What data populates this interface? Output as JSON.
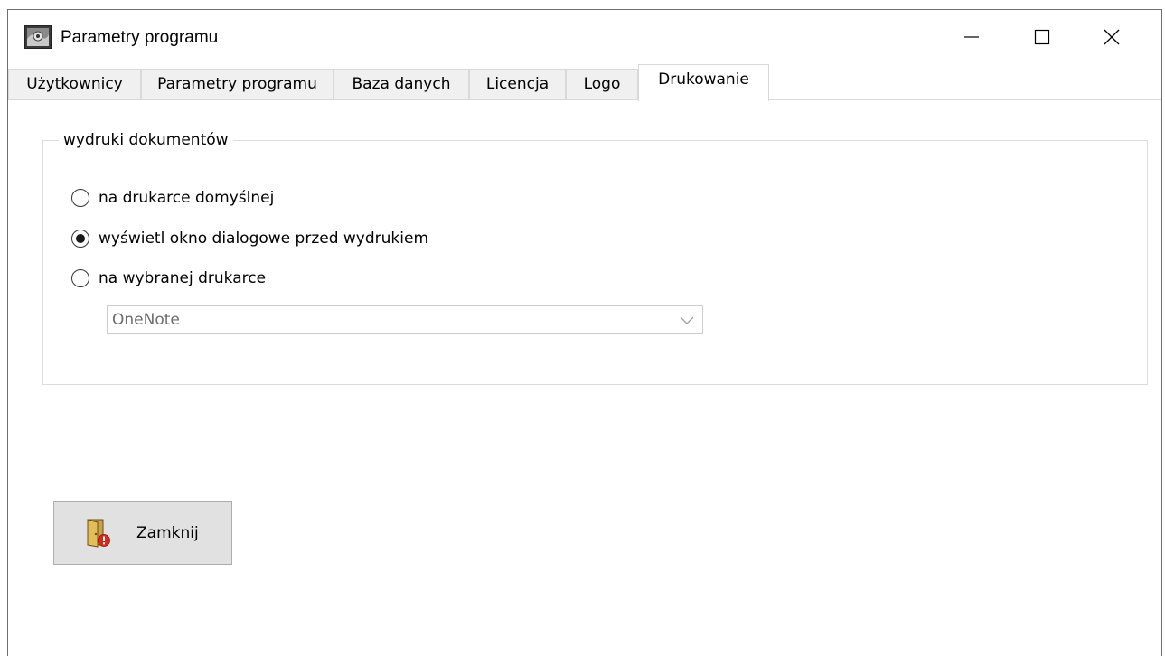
{
  "window": {
    "title": "Parametry programu",
    "controls": {
      "minimize": "minimize-icon",
      "maximize": "maximize-icon",
      "close": "close-icon"
    }
  },
  "tabs": [
    {
      "label": "Użytkownicy"
    },
    {
      "label": "Parametry programu"
    },
    {
      "label": "Baza danych"
    },
    {
      "label": "Licencja"
    },
    {
      "label": "Logo"
    },
    {
      "label": "Drukowanie",
      "active": true
    }
  ],
  "printing": {
    "group_label": "wydruki dokumentów",
    "options": [
      {
        "label": "na drukarce domyślnej",
        "checked": false
      },
      {
        "label": "wyświetl okno dialogowe przed wydrukiem",
        "checked": true
      },
      {
        "label": "na wybranej drukarce",
        "checked": false
      }
    ],
    "printer_select": {
      "value": "OneNote",
      "disabled": true
    }
  },
  "footer": {
    "close_label": "Zamknij",
    "close_icon": "exit-door-icon"
  },
  "colors": {
    "window_bg": "#f0f0f0",
    "panel_bg": "#ffffff",
    "button_bg": "#e1e1e1",
    "disabled_text": "#6d6d6d"
  }
}
